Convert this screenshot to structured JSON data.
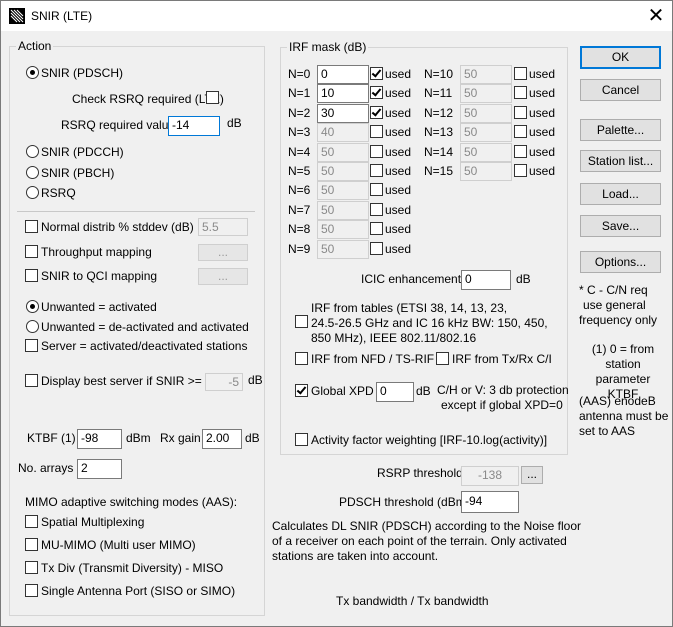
{
  "window": {
    "title": "SNIR (LTE)"
  },
  "action": {
    "group_label": "Action",
    "snir_pdsch": "SNIR (PDSCH)",
    "check_rsrq": "Check RSRQ required (LTE)",
    "rsrq_required_label": "RSRQ required value",
    "rsrq_required_value": "-14",
    "rsrq_unit": "dB",
    "snir_pdcch": "SNIR (PDCCH)",
    "snir_pbch": "SNIR (PBCH)",
    "rsrq": "RSRQ",
    "normal_distrib": "Normal distrib % stddev (dB)",
    "normal_distrib_value": "5.5",
    "throughput_mapping": "Throughput mapping",
    "throughput_btn": "...",
    "snir_qci": "SNIR to QCI mapping",
    "snir_qci_btn": "...",
    "unwanted_activated": "Unwanted = activated",
    "unwanted_deactivated": "Unwanted = de-activated and activated",
    "server_activated": "Server = activated/deactivated stations",
    "display_best": "Display best server if SNIR >=",
    "display_best_value": "-5",
    "display_best_unit": "dB",
    "ktbf_label": "KTBF (1)",
    "ktbf_value": "-98",
    "ktbf_unit": "dBm",
    "rxgain_label": "Rx gain",
    "rxgain_value": "2.00",
    "rxgain_unit": "dB"
  },
  "no_arrays": {
    "label": "No. arrays",
    "value": "2"
  },
  "mimo": {
    "title": "MIMO adaptive switching modes (AAS):",
    "spatial": "Spatial Multiplexing",
    "mumimo": "MU-MIMO (Multi user MIMO)",
    "txdiv": "Tx Div (Transmit Diversity) - MISO",
    "single": "Single Antenna Port (SISO or SIMO)"
  },
  "irf": {
    "group_label": "IRF mask (dB)",
    "used_label": "used",
    "left": [
      {
        "n": "N=0",
        "value": "0",
        "used": true,
        "enabled": true
      },
      {
        "n": "N=1",
        "value": "10",
        "used": true,
        "enabled": true
      },
      {
        "n": "N=2",
        "value": "30",
        "used": true,
        "enabled": true
      },
      {
        "n": "N=3",
        "value": "40",
        "used": false,
        "enabled": false
      },
      {
        "n": "N=4",
        "value": "50",
        "used": false,
        "enabled": false
      },
      {
        "n": "N=5",
        "value": "50",
        "used": false,
        "enabled": false
      },
      {
        "n": "N=6",
        "value": "50",
        "used": false,
        "enabled": false
      },
      {
        "n": "N=7",
        "value": "50",
        "used": false,
        "enabled": false
      },
      {
        "n": "N=8",
        "value": "50",
        "used": false,
        "enabled": false
      },
      {
        "n": "N=9",
        "value": "50",
        "used": false,
        "enabled": false
      }
    ],
    "right": [
      {
        "n": "N=10",
        "value": "50",
        "used": false
      },
      {
        "n": "N=11",
        "value": "50",
        "used": false
      },
      {
        "n": "N=12",
        "value": "50",
        "used": false
      },
      {
        "n": "N=13",
        "value": "50",
        "used": false
      },
      {
        "n": "N=14",
        "value": "50",
        "used": false
      },
      {
        "n": "N=15",
        "value": "50",
        "used": false
      }
    ],
    "icic_label": "ICIC enhancement",
    "icic_value": "0",
    "icic_unit": "dB",
    "from_tables_line1": "IRF from tables (ETSI 38, 14, 13, 23,",
    "from_tables_line2": "24.5-26.5 GHz and IC 16 kHz BW: 150, 450,",
    "from_tables_line3": "850 MHz), IEEE 802.11/802.16",
    "from_nfd": "IRF from NFD / TS-RIF",
    "from_txrx": "IRF from Tx/Rx C/I",
    "global_xpd": "Global XPD",
    "global_xpd_value": "0",
    "global_xpd_unit": "dB",
    "xpd_note_line1": "C/H or V: 3 db protection",
    "xpd_note_line2": "except if global XPD=0",
    "activity": "Activity factor weighting [IRF-10.log(activity)]"
  },
  "rsrp": {
    "label": "RSRP threshold",
    "value": "-138",
    "btn": "..."
  },
  "pdsch": {
    "label": "PDSCH threshold (dBm)",
    "value": "-94"
  },
  "description": {
    "line1": "Calculates DL SNIR (PDSCH) according to the Noise floor",
    "line2": "of a receiver on each point of the terrain. Only activated",
    "line3": "stations are taken into account."
  },
  "tx_bandwidth": "Tx bandwidth / Tx bandwidth",
  "buttons": {
    "ok": "OK",
    "cancel": "Cancel",
    "palette": "Palette...",
    "station_list": "Station list...",
    "load": "Load...",
    "save": "Save...",
    "options": "Options..."
  },
  "notes": {
    "cn_line1": "* C - C/N req",
    "cn_line2": "use general",
    "cn_line3": "frequency only",
    "ktbf_line1": "(1) 0 = from",
    "ktbf_line2": "station",
    "ktbf_line3": "parameter KTBF",
    "aas_line1": "(AAS) enodeB",
    "aas_line2": "antenna must be",
    "aas_line3": "set to AAS"
  }
}
